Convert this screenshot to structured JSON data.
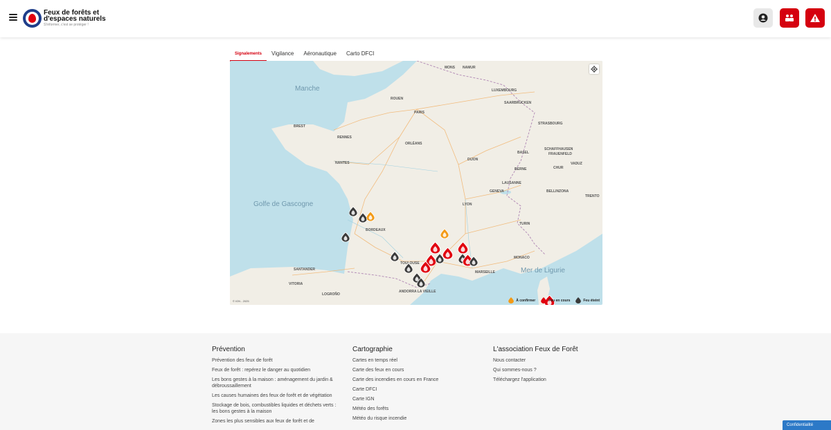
{
  "header": {
    "title": "Feux de forêts et d'espaces naturels",
    "tagline": "S'informer, c'est se protéger !"
  },
  "tabs": [
    {
      "label": "Signalements",
      "active": true
    },
    {
      "label": "Vigilance",
      "active": false
    },
    {
      "label": "Aéronautique",
      "active": false
    },
    {
      "label": "Carto DFCI",
      "active": false
    }
  ],
  "map": {
    "copyright": "© IGN - 2025",
    "seas": [
      "Manche",
      "Golfe de Gascogne",
      "Mer de Ligurie"
    ],
    "cities": [
      "MONS",
      "NAMUR",
      "LUXEMBOURG",
      "ROUEN",
      "PARIS",
      "SAARBRÜCKEN",
      "STRASBOURG",
      "ORLÉANS",
      "BASEL",
      "SCHAFFHAUSEN",
      "FRAUENFELD",
      "VADUZ",
      "NANTES",
      "DIJON",
      "BERNE",
      "CHUR",
      "LAUSANNE",
      "GENEVA",
      "BELLINZONA",
      "TRENTO",
      "LYON",
      "TURIN",
      "BORDEAUX",
      "MONACO",
      "TOULOUSE",
      "MARSEILLE",
      "SANTANDER",
      "ANDORRA LA VIEILLE",
      "VITORIA",
      "LOGROÑO",
      "RENNES",
      "BREST"
    ],
    "legend": [
      {
        "label": "À confirmer",
        "color": "#f39a16"
      },
      {
        "label": "Feu en cours",
        "color": "#e1000f"
      },
      {
        "label": "Feu éteint",
        "color": "#3a3a3a"
      }
    ],
    "colors": {
      "to_confirm": "#f39a16",
      "in_progress": "#e1000f",
      "extinct": "#3a3a3a",
      "accent": "#d5000f"
    }
  },
  "footer": {
    "columns": [
      {
        "title": "Prévention",
        "links": [
          "Prévention des feux de forêt",
          "Feux de forêt : repérez le danger au quotidien",
          "Les bons gestes à la maison : aménagement du jardin & débroussaillement",
          "Les causes humaines des feux de forêt et de végétation",
          "Stockage de bois, combustibles liquides et déchets verts : les bons gestes à la maison",
          "Zones les plus sensibles aux feux de forêt et de"
        ]
      },
      {
        "title": "Cartographie",
        "links": [
          "Cartes en temps réel",
          "Carte des feux en cours",
          "Carte des incendies en cours en France",
          "Carte DFCI",
          "Carte IGN",
          "Météo des forêts",
          "Météo du risque incendie"
        ]
      },
      {
        "title": "L'association Feux de Forêt",
        "links": [
          "Nous contacter",
          "Qui sommes-nous ?",
          "Téléchargez l'application"
        ]
      }
    ],
    "privacy": "Confidentialité"
  }
}
